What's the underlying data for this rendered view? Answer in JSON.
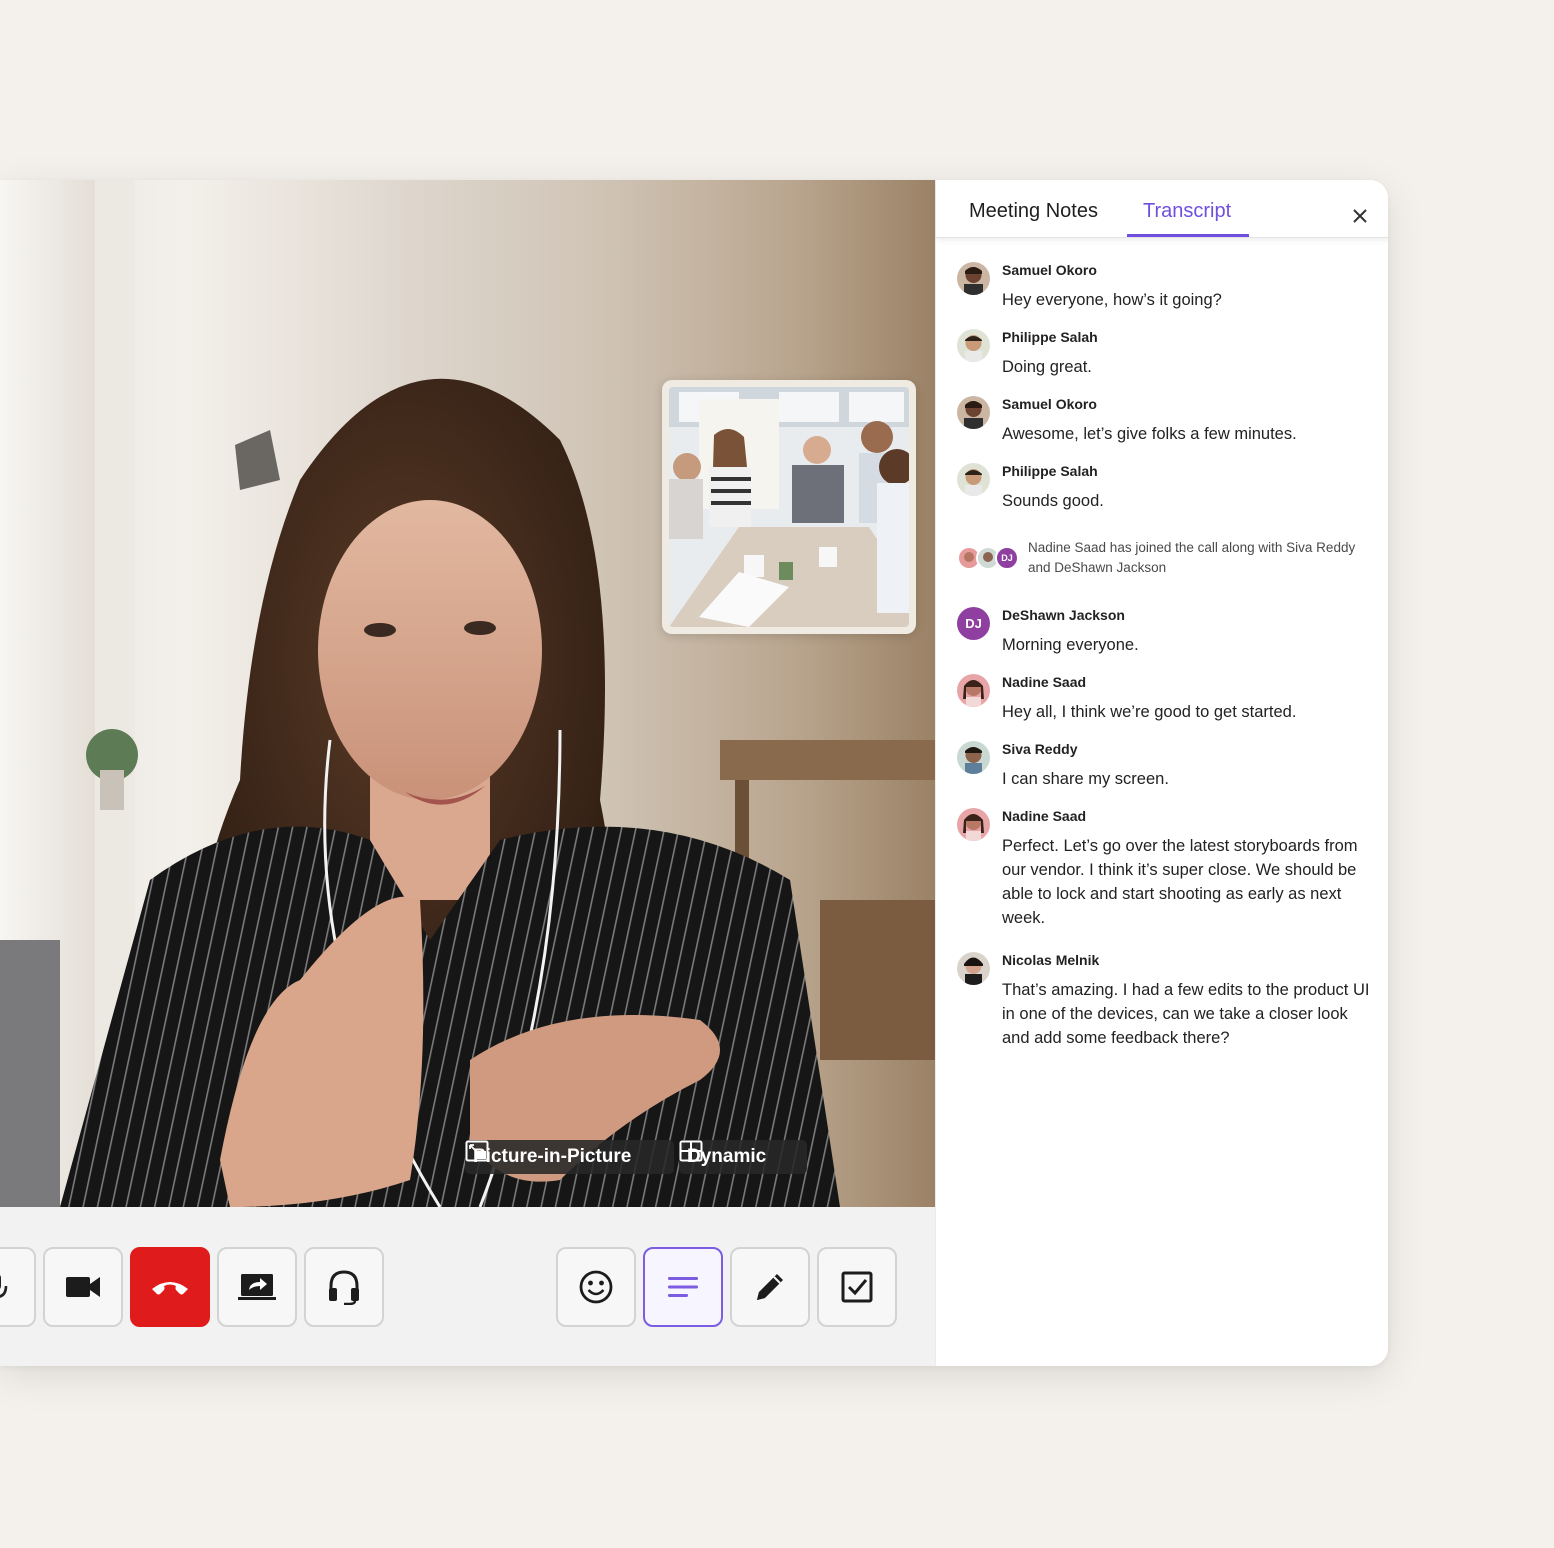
{
  "layout_buttons": {
    "pip_label": "Picture-in-Picture",
    "dynamic_label": "Dynamic"
  },
  "controls": [
    {
      "name": "microphone-icon"
    },
    {
      "name": "video-camera-icon"
    },
    {
      "name": "end-call-icon",
      "color": "#e01b1b"
    },
    {
      "name": "share-screen-icon"
    },
    {
      "name": "headset-icon"
    },
    {
      "name": "emoji-icon"
    },
    {
      "name": "transcript-icon",
      "active": true,
      "color": "#7c5ce0"
    },
    {
      "name": "pencil-icon"
    },
    {
      "name": "checkbox-icon"
    }
  ],
  "panel": {
    "tabs": [
      {
        "label": "Meeting Notes",
        "active": false
      },
      {
        "label": "Transcript",
        "active": true
      }
    ],
    "accent_color": "#6e4fe0",
    "messages": [
      {
        "name": "Samuel Okoro",
        "text": "Hey everyone, how’s it going?"
      },
      {
        "name": "Philippe Salah",
        "text": "Doing great."
      },
      {
        "name": "Samuel Okoro",
        "text": "Awesome, let’s give folks a few minutes."
      },
      {
        "name": "Philippe Salah",
        "text": "Sounds good."
      },
      {
        "name": "DeShawn Jackson",
        "initials": "DJ",
        "text": "Morning everyone."
      },
      {
        "name": "Nadine Saad",
        "text": "Hey all, I think we’re good to get started."
      },
      {
        "name": "Siva Reddy",
        "text": "I can share my screen."
      },
      {
        "name": "Nadine Saad",
        "text": "Perfect. Let’s go over the latest storyboards from our vendor. I think it’s super close. We should be able to lock and start shooting as early as next week."
      },
      {
        "name": "Nicolas Melnik",
        "text": "That’s amazing. I had a few edits to the product UI in one of the devices, can we take a closer look and add some feedback there?"
      }
    ],
    "system_message": {
      "initials": "DJ",
      "text": "Nadine Saad has joined the call along with Siva Reddy and DeShawn Jackson"
    }
  }
}
